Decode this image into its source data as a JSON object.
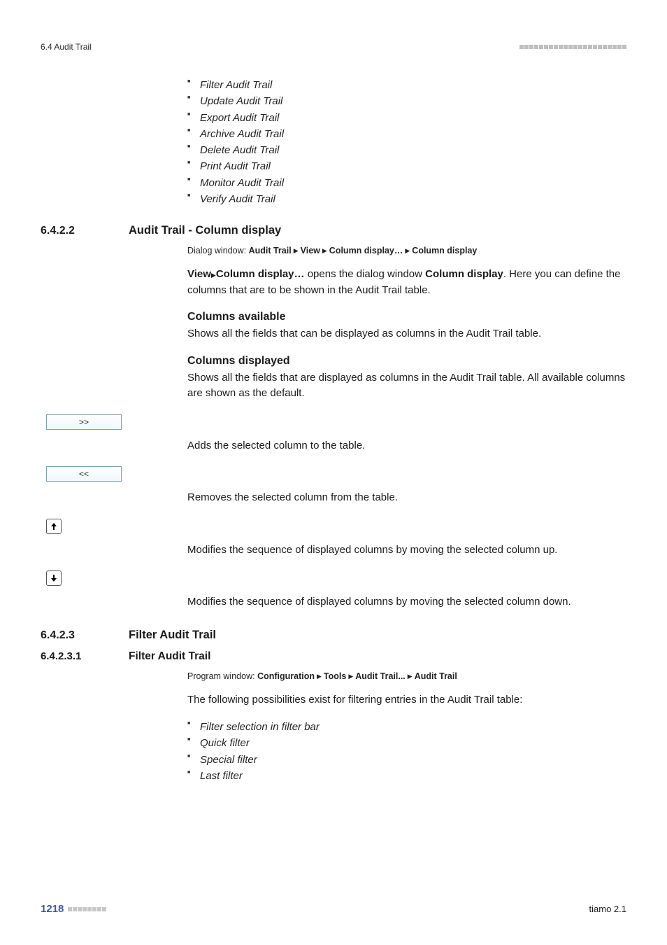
{
  "header": {
    "section_label": "6.4 Audit Trail"
  },
  "top_list": [
    "Filter Audit Trail",
    "Update Audit Trail",
    "Export Audit Trail",
    "Archive Audit Trail",
    "Delete Audit Trail",
    "Print Audit Trail",
    "Monitor Audit Trail",
    "Verify Audit Trail"
  ],
  "s6422": {
    "num": "6.4.2.2",
    "title": "Audit Trail - Column display",
    "crumb": {
      "prefix": "Dialog window:",
      "parts": [
        "Audit Trail",
        "View",
        "Column display…",
        "Column display"
      ]
    },
    "intro_pre": "View",
    "intro_action": "Column display…",
    "intro_mid": " opens the dialog window ",
    "intro_obj": "Column display",
    "intro_tail": ". Here you can define the columns that are to be shown in the Audit Trail table.",
    "cols_avail_h": "Columns available",
    "cols_avail_p": "Shows all the fields that can be displayed as columns in the Audit Trail table.",
    "cols_disp_h": "Columns displayed",
    "cols_disp_p": "Shows all the fields that are displayed as columns in the Audit Trail table. All available columns are shown as the default.",
    "btn_add": ">>",
    "btn_add_desc": "Adds the selected column to the table.",
    "btn_rem": "<<",
    "btn_rem_desc": "Removes the selected column from the table.",
    "btn_up_desc": "Modifies the sequence of displayed columns by moving the selected column up.",
    "btn_down_desc": "Modifies the sequence of displayed columns by moving the selected column down."
  },
  "s6423": {
    "num": "6.4.2.3",
    "title": "Filter Audit Trail"
  },
  "s64231": {
    "num": "6.4.2.3.1",
    "title": "Filter Audit Trail",
    "crumb": {
      "prefix": "Program window:",
      "parts": [
        "Configuration",
        "Tools",
        "Audit Trail...",
        "Audit Trail"
      ]
    },
    "intro": "The following possibilities exist for filtering entries in the Audit Trail table:",
    "list": [
      "Filter selection in filter bar",
      "Quick filter",
      "Special filter",
      "Last filter"
    ]
  },
  "footer": {
    "page": "1218",
    "product": "tiamo 2.1"
  }
}
